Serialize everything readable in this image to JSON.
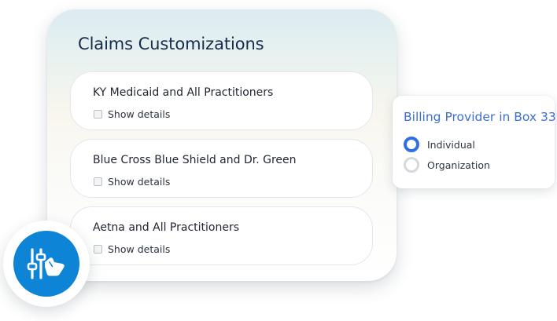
{
  "customizations": {
    "title": "Claims Customizations",
    "items": [
      {
        "title": "KY Medicaid and All Practitioners",
        "details_label": "Show details"
      },
      {
        "title": "Blue Cross Blue Shield and Dr. Green",
        "details_label": "Show details"
      },
      {
        "title": "Aetna and All Practitioners",
        "details_label": "Show details"
      }
    ]
  },
  "billing": {
    "title": "Billing Provider in Box 33",
    "options": [
      {
        "label": "Individual",
        "selected": true
      },
      {
        "label": "Organization",
        "selected": false
      }
    ]
  },
  "badge": {
    "icon": "sliders-hand-icon"
  },
  "colors": {
    "accent": "#2f6fe0",
    "badge": "#0d84d6",
    "title_text": "#172b4d"
  }
}
